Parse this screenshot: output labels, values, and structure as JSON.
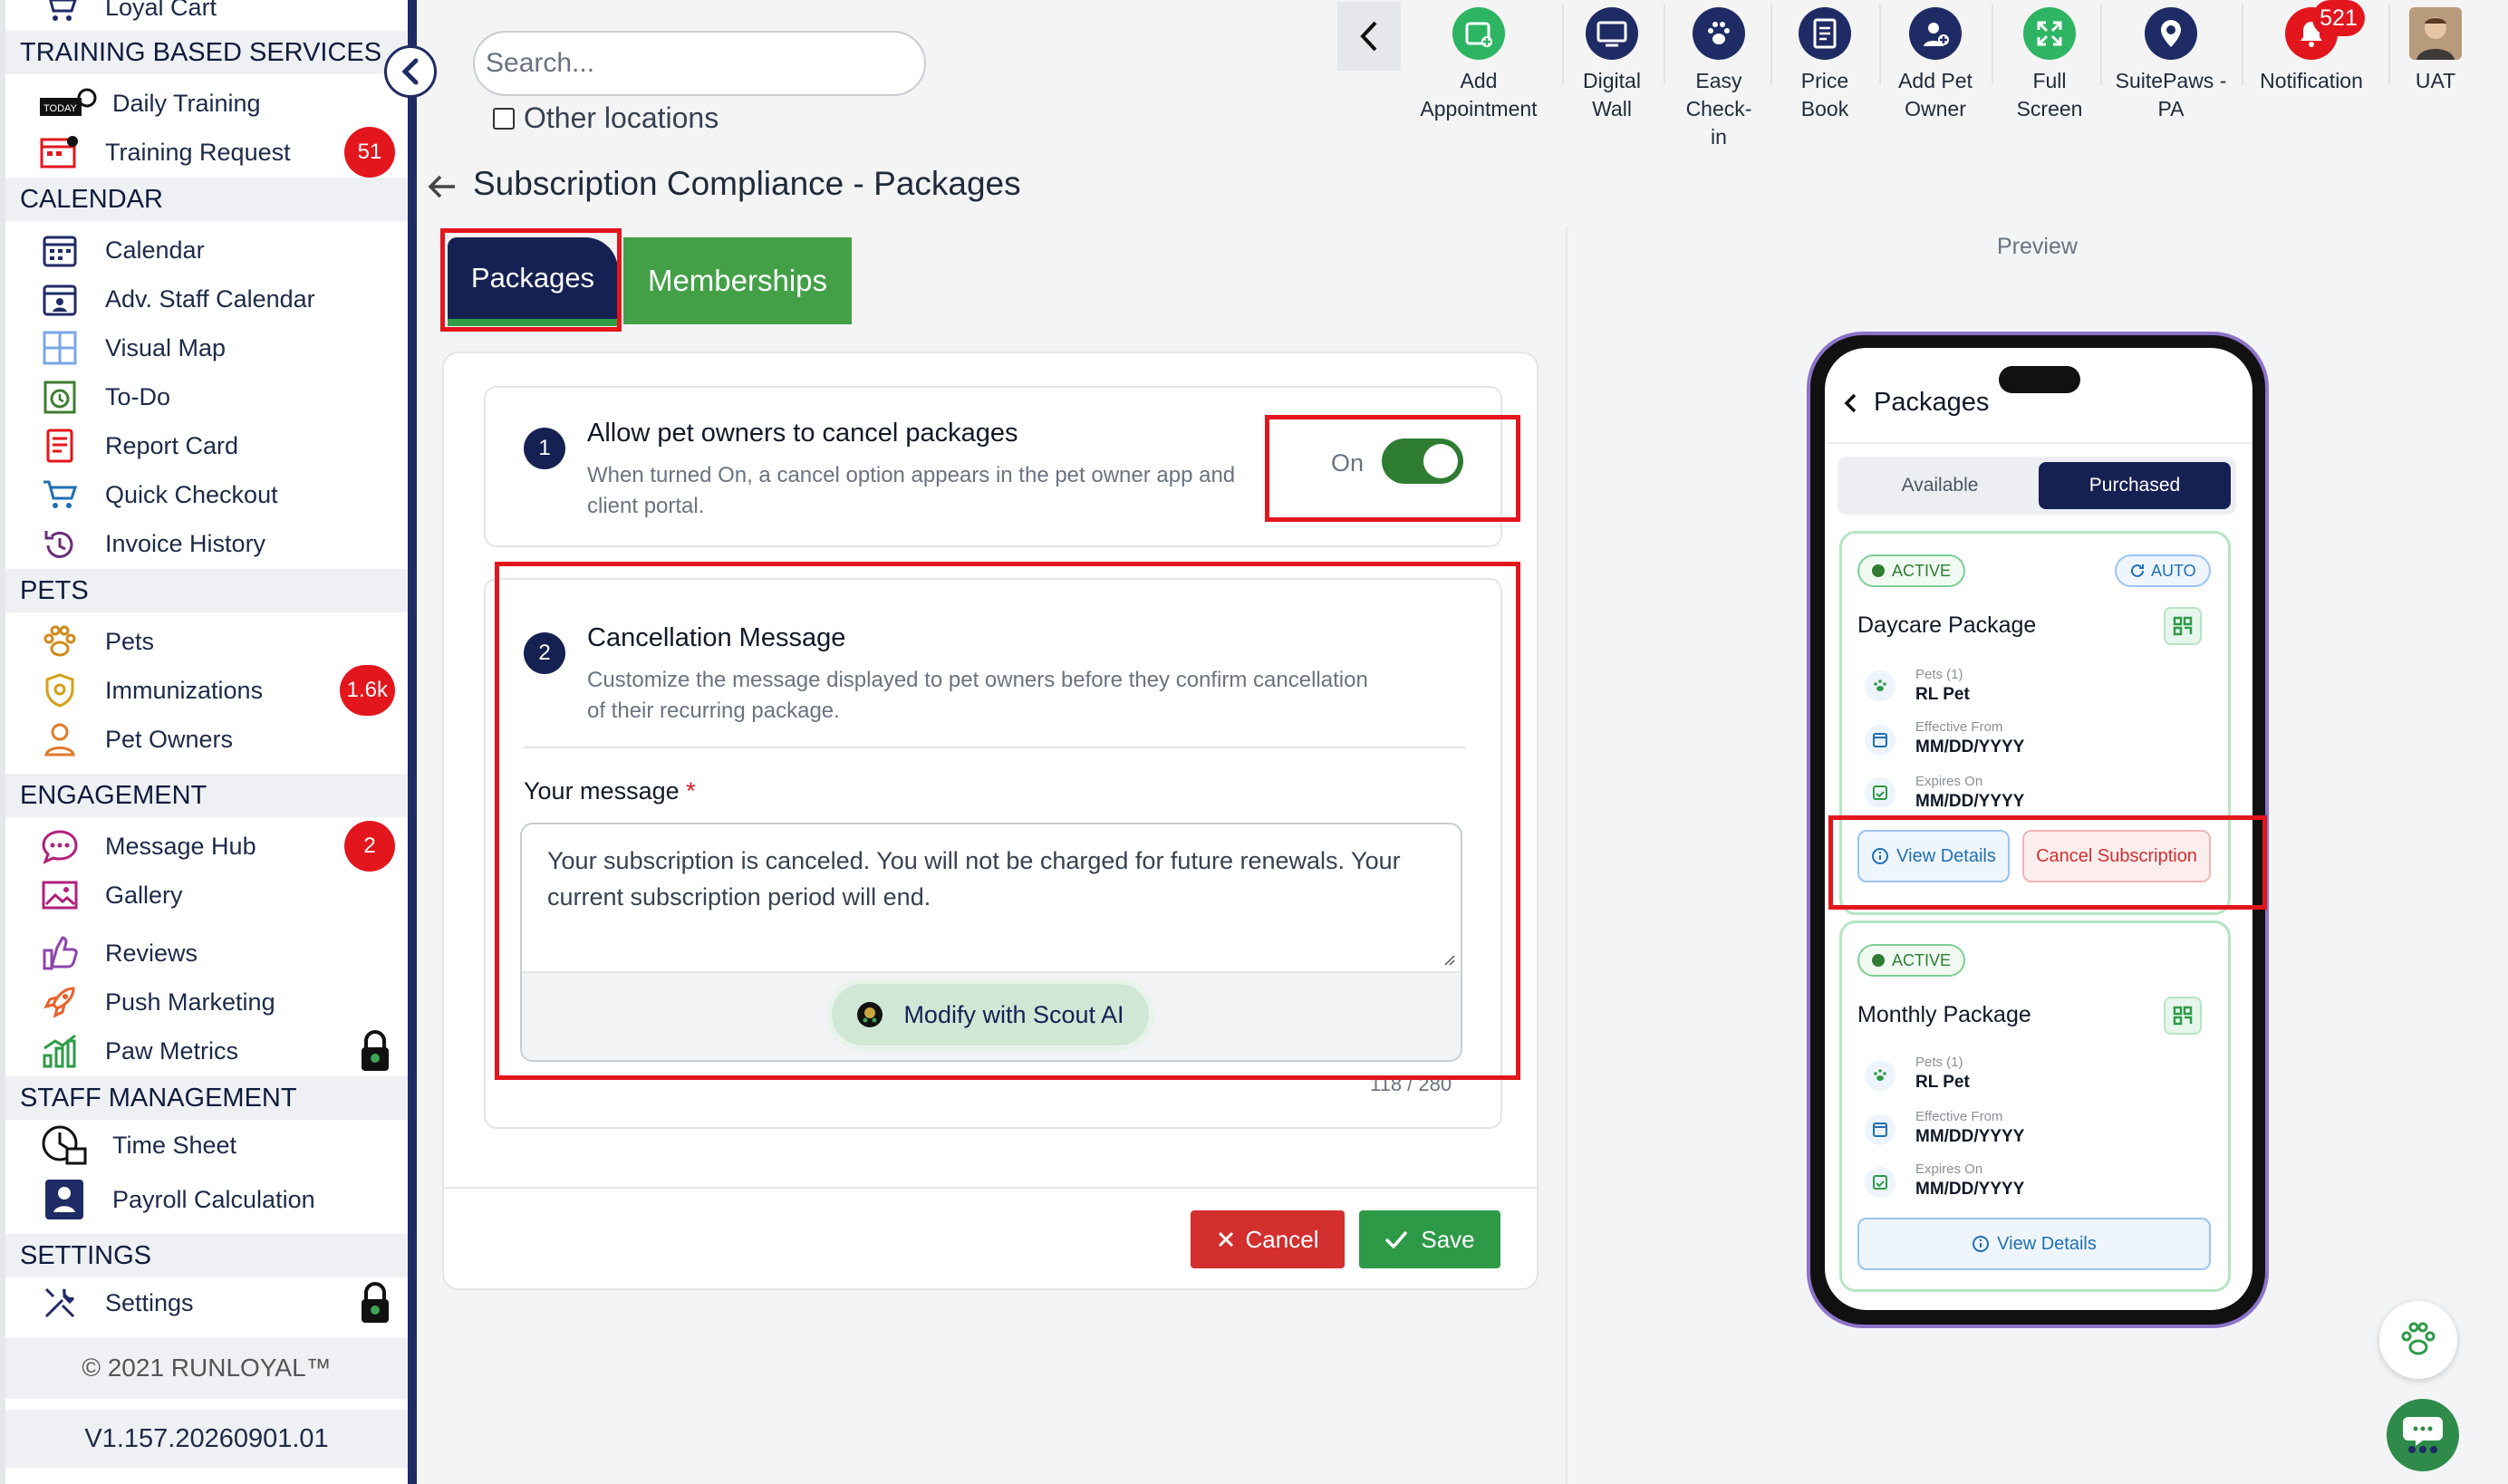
{
  "sidebar": {
    "top_partial_label": "Loyal Cart",
    "sections": {
      "training": "TRAINING BASED SERVICES",
      "calendar": "CALENDAR",
      "pets": "PETS",
      "engagement": "ENGAGEMENT",
      "staff": "STAFF MANAGEMENT",
      "settings": "SETTINGS"
    },
    "items": {
      "daily_training": "Daily Training",
      "training_request": "Training Request",
      "calendar": "Calendar",
      "adv_staff_calendar": "Adv. Staff Calendar",
      "visual_map": "Visual Map",
      "todo": "To-Do",
      "report_card": "Report Card",
      "quick_checkout": "Quick Checkout",
      "invoice_history": "Invoice History",
      "pets": "Pets",
      "immunizations": "Immunizations",
      "pet_owners": "Pet Owners",
      "message_hub": "Message Hub",
      "gallery": "Gallery",
      "reviews": "Reviews",
      "push_marketing": "Push Marketing",
      "paw_metrics": "Paw Metrics",
      "time_sheet": "Time Sheet",
      "payroll_calculation": "Payroll Calculation",
      "settings": "Settings"
    },
    "badges": {
      "training_request": "51",
      "immunizations": "1.6k",
      "message_hub": "2"
    },
    "today_icon_text": "TODAY",
    "copyright": "© 2021  RUNLOYAL™",
    "version": "V1.157.20260901.01"
  },
  "topbar": {
    "search_placeholder": "Search...",
    "other_locations": "Other locations",
    "tools": {
      "add_appointment": "Add Appointment",
      "digital_wall": "Digital Wall",
      "easy_checkin": "Easy Check-in",
      "price_book": "Price Book",
      "add_pet_owner": "Add Pet Owner",
      "full_screen": "Full Screen",
      "suitepaws": "SuitePaws - PA",
      "notification": "Notification",
      "user": "UAT"
    },
    "notification_count": "521"
  },
  "page": {
    "title": "Subscription Compliance - Packages",
    "tabs": {
      "packages": "Packages",
      "memberships": "Memberships"
    }
  },
  "settings_form": {
    "allow_cancel": {
      "number": "1",
      "title": "Allow pet owners to cancel packages",
      "description_line1": "When turned On, a cancel option appears in the pet owner app and",
      "description_line2": "client portal.",
      "toggle_label": "On",
      "toggle_on": true
    },
    "cancel_message": {
      "number": "2",
      "title": "Cancellation Message",
      "description_line1": "Customize the message displayed to pet owners before they confirm cancellation",
      "description_line2": "of their recurring package.",
      "field_label": "Your message",
      "required_mark": "*",
      "message": "Your subscription is canceled. You will not be charged for future renewals. Your current subscription period will end.",
      "ai_button": "Modify with Scout AI",
      "char_count": "118 / 280"
    },
    "buttons": {
      "cancel": "Cancel",
      "save": "Save"
    }
  },
  "preview": {
    "label": "Preview",
    "header": "Packages",
    "tabs": {
      "available": "Available",
      "purchased": "Purchased"
    },
    "packages": [
      {
        "status": "ACTIVE",
        "auto": "AUTO",
        "name": "Daycare Package",
        "pets_label": "Pets (1)",
        "pets_value": "RL Pet",
        "eff_label": "Effective From",
        "eff_value": "MM/DD/YYYY",
        "exp_label": "Expires On",
        "exp_value": "MM/DD/YYYY",
        "view_details": "View Details",
        "cancel_sub": "Cancel Subscription"
      },
      {
        "status": "ACTIVE",
        "name": "Monthly Package",
        "pets_label": "Pets (1)",
        "pets_value": "RL Pet",
        "eff_label": "Effective From",
        "eff_value": "MM/DD/YYYY",
        "exp_label": "Expires On",
        "exp_value": "MM/DD/YYYY",
        "view_details": "View Details"
      }
    ]
  },
  "colors": {
    "navy": "#152152",
    "green": "#43a047",
    "red": "#e3161d",
    "sidebar_border": "#1f2b64"
  }
}
